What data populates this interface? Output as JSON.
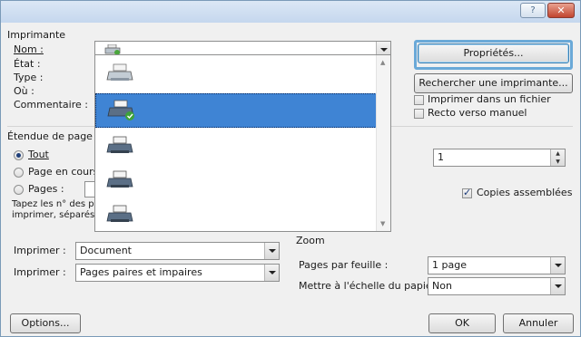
{
  "titlebar": {
    "help": "?",
    "close": "✕"
  },
  "printer": {
    "group_label": "Imprimante",
    "name_label": "Nom :",
    "state_label": "État :",
    "type_label": "Type :",
    "where_label": "Où :",
    "comment_label": "Commentaire :",
    "properties_button": "Propriétés...",
    "find_printer_button": "Rechercher une imprimante...",
    "print_to_file": "Imprimer dans un fichier",
    "duplex_manual": "Recto verso manuel"
  },
  "range": {
    "group_label": "Étendue de page",
    "all": "Tout",
    "current_page": "Page en cours",
    "pages": "Pages :",
    "hint_line1": "Tapez les n° des p",
    "hint_line2": "imprimer, séparés"
  },
  "copies": {
    "value": "1",
    "collate": "Copies assemblées"
  },
  "print_what": {
    "label": "Imprimer :",
    "value": "Document"
  },
  "print_which": {
    "label": "Imprimer :",
    "value": "Pages paires et impaires"
  },
  "zoom": {
    "label": "Zoom",
    "pages_per_sheet_label": "Pages par feuille :",
    "pages_per_sheet_value": "1 page",
    "scale_label": "Mettre à l'échelle du papier :",
    "scale_value": "Non"
  },
  "buttons": {
    "options": "Options...",
    "ok": "OK",
    "cancel": "Annuler"
  },
  "colors": {
    "selection": "#3f84d4",
    "focus": "#6aa9d8"
  }
}
